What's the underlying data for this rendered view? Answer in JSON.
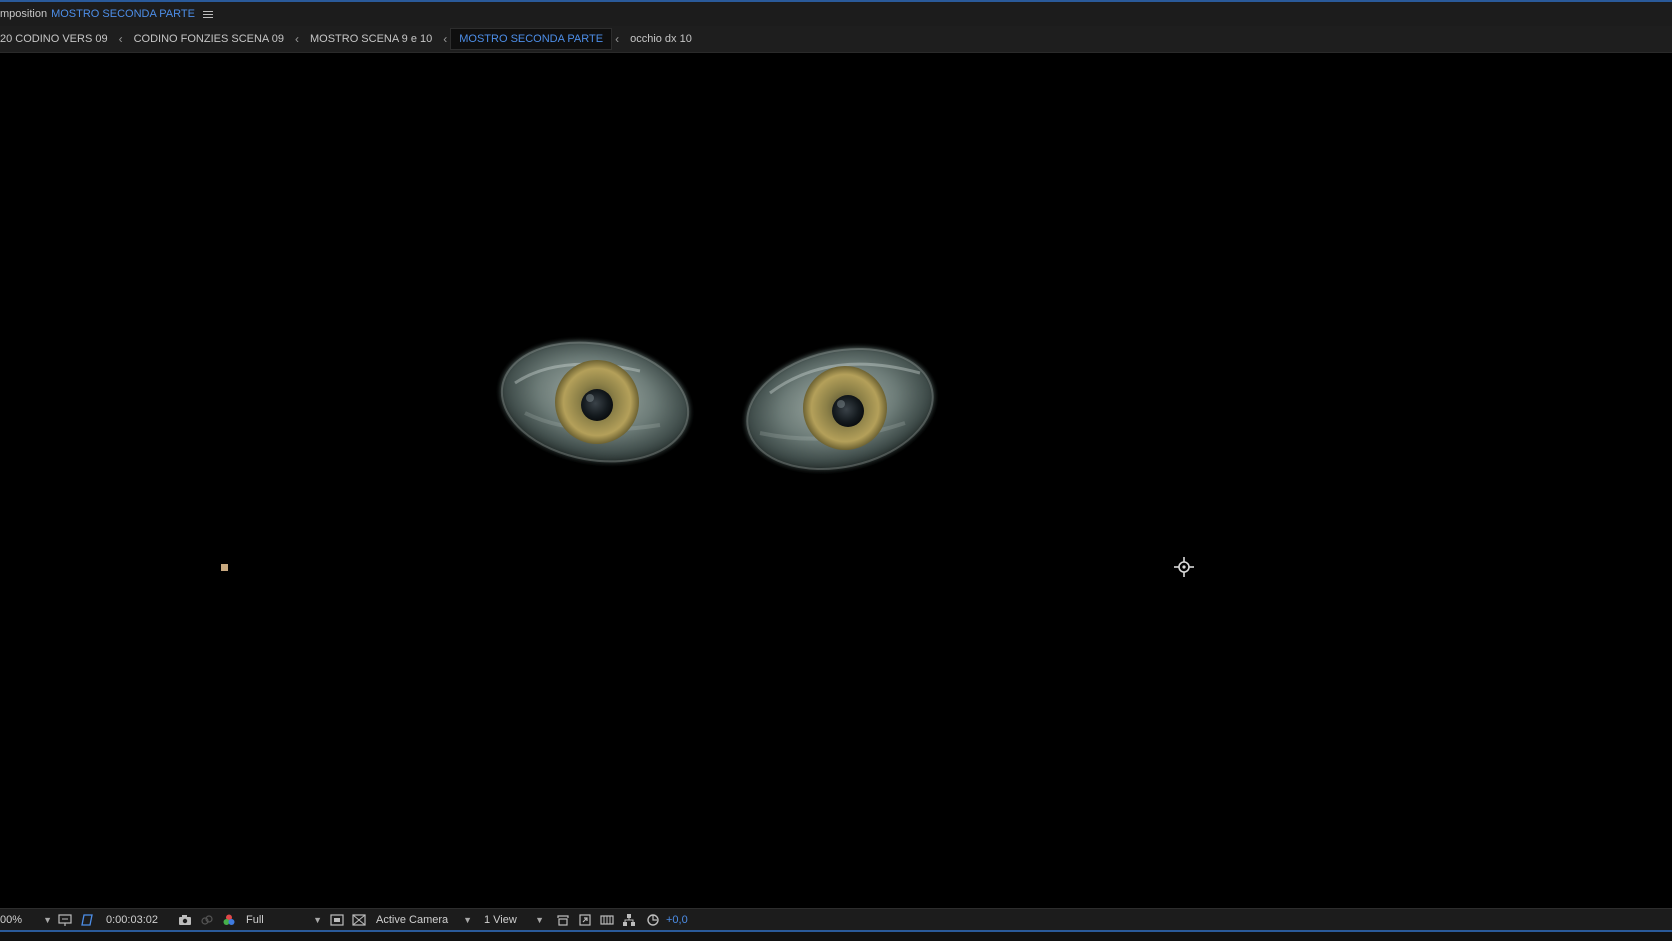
{
  "panel": {
    "title_prefix": "mposition",
    "composition_name": "MOSTRO SECONDA PARTE",
    "menu_icon": "hamburger-menu-icon"
  },
  "breadcrumb": {
    "items": [
      {
        "label": "20 CODINO VERS 09",
        "active": false
      },
      {
        "label": "CODINO FONZIES SCENA 09",
        "active": false
      },
      {
        "label": "MOSTRO SCENA 9 e 10",
        "active": false
      },
      {
        "label": "MOSTRO SECONDA PARTE",
        "active": true
      },
      {
        "label": "occhio dx 10",
        "active": false
      }
    ],
    "separator": "‹"
  },
  "colors": {
    "accent_blue": "#4d8ee8",
    "panel_bg": "#1c1c1c",
    "viewer_bg": "#000000",
    "anchor_point": "#c8a980"
  },
  "viewer": {
    "content": "two-eyes",
    "target_icon": "3d-target-icon"
  },
  "toolbar": {
    "zoom": "00%",
    "timecode": "0:00:03:02",
    "resolution": "Full",
    "camera": "Active Camera",
    "view_layout": "1 View",
    "exposure": "+0,0",
    "icons": {
      "fit": "region-of-interest-icon",
      "transparency": "transparency-grid-icon",
      "snapshot": "camera-snapshot-icon",
      "show_snapshot": "show-snapshot-icon",
      "color": "channels-color-icon",
      "fast_preview": "fast-previews-icon",
      "grid": "toggle-grid-icon",
      "draft3d": "draft-3d-icon",
      "timeline": "timeline-icon",
      "flowchart": "flowchart-icon",
      "reset_exposure": "reset-exposure-icon"
    }
  }
}
